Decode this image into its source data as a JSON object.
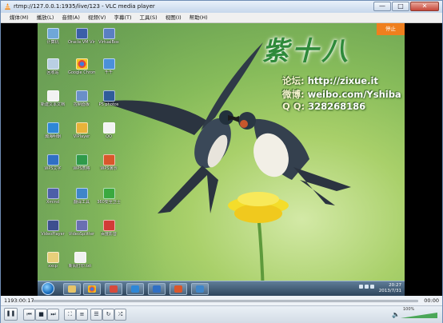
{
  "window": {
    "title": "rtmp://127.0.0.1:1935/live/123 - VLC media player",
    "controls": {
      "minimize": "—",
      "maximize": "□",
      "close": "✕"
    }
  },
  "menu": {
    "items": [
      "媒体(M)",
      "播放(L)",
      "音频(A)",
      "视频(V)",
      "字幕(T)",
      "工具(S)",
      "视图(I)",
      "帮助(H)"
    ]
  },
  "video": {
    "corner_button": "停止",
    "logo_text": "紫十八",
    "lines": [
      {
        "key": "论坛:",
        "value": "http://zixue.it"
      },
      {
        "key": "微博:",
        "value": "weibo.com/Yshiba"
      },
      {
        "key": "Q Q:",
        "value": "328268186"
      }
    ],
    "desktop_icons": [
      {
        "label": "计算机"
      },
      {
        "label": "Oracle VM VirtualBox"
      },
      {
        "label": "VirtualBox"
      },
      {
        "label": "回收站"
      },
      {
        "label": "Google Chrome"
      },
      {
        "label": "千千"
      },
      {
        "label": "新建文本文档"
      },
      {
        "label": "控制面板"
      },
      {
        "label": "PS photos"
      },
      {
        "label": "瀚海明朝"
      },
      {
        "label": "VIPlayer"
      },
      {
        "label": "QQ"
      },
      {
        "label": "WPS文字"
      },
      {
        "label": "WPS表格"
      },
      {
        "label": "WPS演示"
      },
      {
        "label": "Xmind"
      },
      {
        "label": "翻译工具"
      },
      {
        "label": "360安全卫士"
      },
      {
        "label": "VideoPlayer"
      },
      {
        "label": "VideoSplitter"
      },
      {
        "label": "百度影音"
      },
      {
        "label": "xxcp"
      },
      {
        "label": "新闻打印.txt"
      }
    ],
    "taskbar": {
      "time": "20:27",
      "date": "2013/7/31"
    }
  },
  "playback": {
    "elapsed": "1193:00:17",
    "total": "00:00",
    "progress": 0,
    "volume_percent": "100%"
  },
  "colors": {
    "accent_orange": "#ef7f1e",
    "logo_green": "#2e8a3a"
  }
}
